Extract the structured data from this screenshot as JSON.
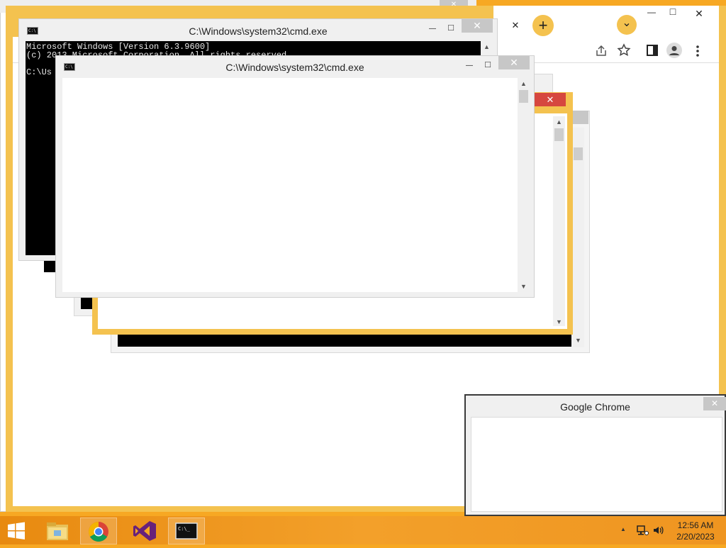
{
  "cmd_window_1": {
    "title": "C:\\Windows\\system32\\cmd.exe",
    "console_lines": [
      "Microsoft Windows [Version 6.3.9600]",
      "(c) 2013 Microsoft Corporation. All rights reserved.",
      "",
      "C:\\Us"
    ],
    "close_glyph": "✕",
    "minimize_glyph": "—",
    "maximize_glyph": "□"
  },
  "cmd_window_2": {
    "title": "C:\\Windows\\system32\\cmd.exe",
    "close_glyph": "✕",
    "minimize_glyph": "—",
    "maximize_glyph": "□"
  },
  "chrome_window": {
    "new_tab_glyph": "+",
    "tab_close_glyph": "✕",
    "dropdown_glyph": "⌄",
    "close_glyph": "✕",
    "minimize_glyph": "—",
    "maximize_glyph": "□",
    "toolbar_icons": [
      "share-icon",
      "star-icon",
      "side-panel-icon",
      "profile-icon",
      "menu-icon"
    ]
  },
  "chrome_dialog": {
    "title": "Google Chrome",
    "close_glyph": "✕"
  },
  "taskbar": {
    "start_icon": "windows-logo-icon",
    "items": [
      "file-explorer-icon",
      "chrome-icon",
      "visual-studio-icon",
      "cmd-icon"
    ],
    "clock_time": "12:56 AM",
    "clock_date": "2/20/2023",
    "tray_arrow": "▲"
  },
  "colors": {
    "accent_orange": "#f7a823",
    "chrome_frame_yellow": "#f4c24f",
    "chrome_close_red": "#d6473f"
  }
}
